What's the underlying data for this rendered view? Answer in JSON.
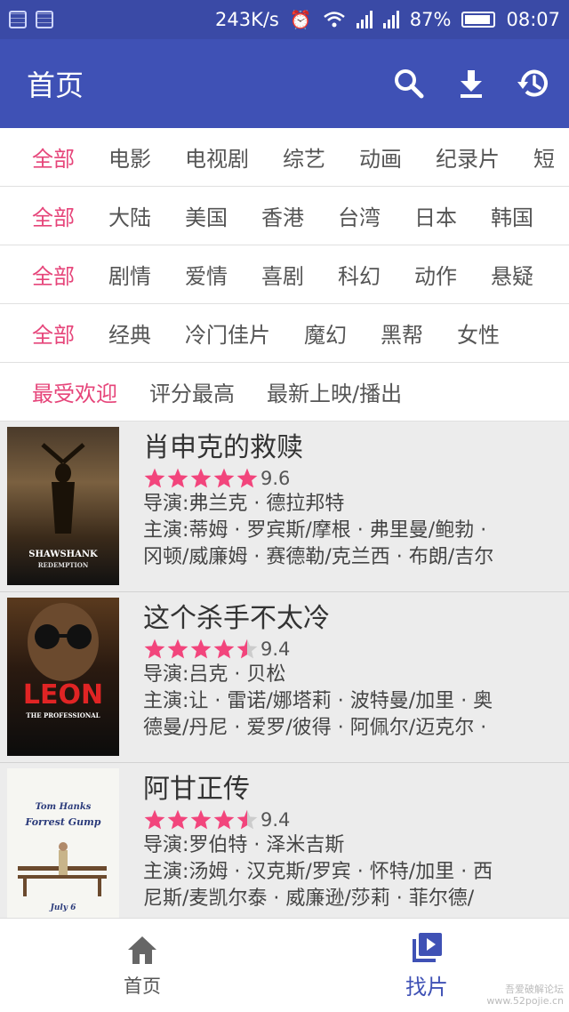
{
  "status_bar": {
    "speed": "243K/s",
    "battery_percent": "87%",
    "time": "08:07",
    "icons": [
      "sim-icon",
      "notification-icon",
      "alarm-icon",
      "wifi-icon",
      "signal-icon",
      "signal-icon",
      "battery-icon"
    ]
  },
  "appbar": {
    "title": "首页",
    "actions": [
      "search-icon",
      "download-icon",
      "history-icon"
    ]
  },
  "filters": {
    "types": [
      "全部",
      "电影",
      "电视剧",
      "综艺",
      "动画",
      "纪录片",
      "短"
    ],
    "regions": [
      "全部",
      "大陆",
      "美国",
      "香港",
      "台湾",
      "日本",
      "韩国"
    ],
    "genres": [
      "全部",
      "剧情",
      "爱情",
      "喜剧",
      "科幻",
      "动作",
      "悬疑"
    ],
    "styles": [
      "全部",
      "经典",
      "冷门佳片",
      "魔幻",
      "黑帮",
      "女性"
    ],
    "sorts": [
      "最受欢迎",
      "评分最高",
      "最新上映/播出"
    ]
  },
  "movies": [
    {
      "title": "肖申克的救赎",
      "rating": 9.6,
      "score": "9.6",
      "stars": 5,
      "director": "导演:弗兰克 · 德拉邦特",
      "cast_line1": "主演:蒂姆 · 罗宾斯/摩根 · 弗里曼/鲍勃 ·",
      "cast_line2": "冈顿/威廉姆 · 赛德勒/克兰西 · 布朗/吉尔",
      "poster_text": [
        "SHAWSHANK",
        "REDEMPTION"
      ]
    },
    {
      "title": "这个杀手不太冷",
      "rating": 9.4,
      "score": "9.4",
      "stars": 4.5,
      "director": "导演:吕克 · 贝松",
      "cast_line1": "主演:让 · 雷诺/娜塔莉 · 波特曼/加里 · 奥",
      "cast_line2": "德曼/丹尼 · 爱罗/彼得 · 阿佩尔/迈克尔 ·",
      "poster_text": [
        "LEON",
        "THE PROFESSIONAL"
      ]
    },
    {
      "title": "阿甘正传",
      "rating": 9.4,
      "score": "9.4",
      "stars": 4.5,
      "director": "导演:罗伯特 · 泽米吉斯",
      "cast_line1": "主演:汤姆 · 汉克斯/罗宾 · 怀特/加里 · 西",
      "cast_line2": "尼斯/麦凯尔泰 · 威廉逊/莎莉 · 菲尔德/",
      "poster_text": [
        "Tom Hanks",
        "Forrest Gump",
        "July 6"
      ]
    }
  ],
  "bottom_nav": {
    "home_label": "首页",
    "find_label": "找片",
    "active": "找片"
  },
  "watermark": [
    "吾爱破解论坛",
    "www.52pojie.cn"
  ],
  "colors": {
    "primary": "#3f51b5",
    "status_bar": "#3a4aa6",
    "accent_pink": "#e6457a",
    "star": "#f2457c",
    "star_empty": "#cccccc"
  }
}
